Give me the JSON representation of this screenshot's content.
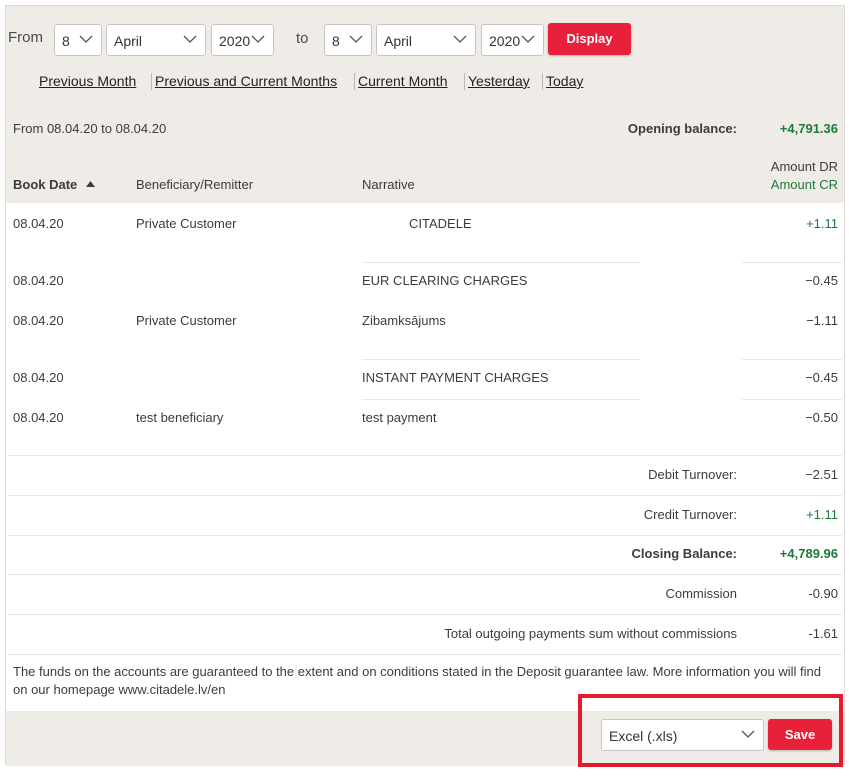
{
  "filters": {
    "from_label": "From",
    "to_label": "to",
    "from_day": "8",
    "from_month": "April",
    "from_year": "2020",
    "to_day": "8",
    "to_month": "April",
    "to_year": "2020",
    "display_label": "Display"
  },
  "quick_links": [
    "Previous Month",
    "Previous and Current Months",
    "Current Month",
    "Yesterday",
    "Today"
  ],
  "statement": {
    "period": "From 08.04.20 to 08.04.20",
    "opening_balance_label": "Opening balance:",
    "opening_balance_value": "+4,791.36"
  },
  "columns": {
    "book_date": "Book Date",
    "beneficiary": "Beneficiary/Remitter",
    "narrative": "Narrative",
    "amount_dr": "Amount DR",
    "amount_cr": "Amount CR"
  },
  "rows": [
    {
      "date": "08.04.20",
      "beneficiary": "Private Customer",
      "narrative": "CITADELE",
      "amount": "+1.11"
    },
    {
      "date": "08.04.20",
      "beneficiary": "",
      "narrative": "EUR CLEARING CHARGES",
      "amount": "−0.45"
    },
    {
      "date": "08.04.20",
      "beneficiary": "Private Customer",
      "narrative": "Zibamksājums",
      "amount": "−1.11"
    },
    {
      "date": "08.04.20",
      "beneficiary": "",
      "narrative": "INSTANT PAYMENT CHARGES",
      "amount": "−0.45"
    },
    {
      "date": "08.04.20",
      "beneficiary": "test beneficiary",
      "narrative": "test payment",
      "amount": "−0.50"
    }
  ],
  "summary": [
    {
      "label": "Debit Turnover:",
      "value": "−2.51"
    },
    {
      "label": "Credit Turnover:",
      "value": "+1.11"
    },
    {
      "label": "Closing Balance:",
      "value": "+4,789.96"
    },
    {
      "label": "Commission",
      "value": "-0.90"
    },
    {
      "label": "Total outgoing payments sum without commissions",
      "value": "-1.61"
    }
  ],
  "notice": "The funds on the accounts are guaranteed to the extent and on conditions stated in the Deposit guarantee law. More information you will find on our homepage www.citadele.lv/en",
  "export": {
    "format": "Excel (.xls)",
    "save_label": "Save"
  },
  "colors": {
    "accent": "#e8203a",
    "positive": "#1f7a3a",
    "panel": "#efebe6",
    "highlight_border": "#e01c2e"
  }
}
